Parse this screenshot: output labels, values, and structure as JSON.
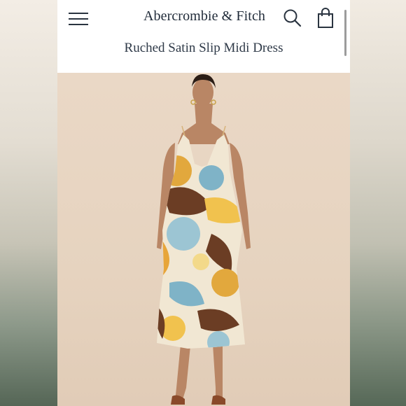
{
  "header": {
    "brand": "Abercrombie & Fitch",
    "menu_icon": "hamburger-menu-icon",
    "search_icon": "search-icon",
    "bag_icon": "shopping-bag-icon"
  },
  "product": {
    "title": "Ruched Satin Slip Midi Dress"
  },
  "colors": {
    "brand_text": "#1f2a38",
    "hero_background": "#e8d6c3"
  }
}
